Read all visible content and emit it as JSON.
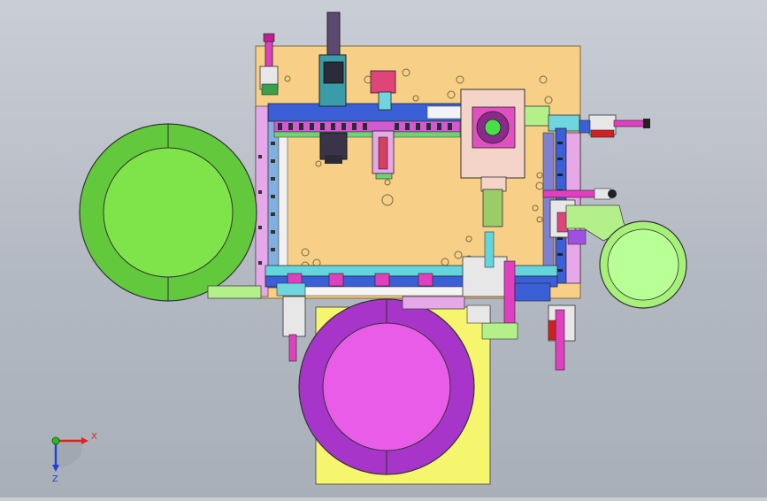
{
  "axis_triad": {
    "x_label": "X",
    "z_label": "Z"
  },
  "colors": {
    "plate": "#f7cf86",
    "plate_edge": "#8a7a55",
    "green_bowl": "#62c93c",
    "green_bowl_inner": "#7fe44a",
    "light_green_bowl": "#a7f07a",
    "light_green_bowl_inner": "#b8ff96",
    "purple_bowl": "#a735c9",
    "purple_bowl_inner": "#e85ce8",
    "yellow_base": "#f6f56e",
    "blue_rail": "#3b5fd6",
    "magenta": "#e040c0",
    "cyan": "#62d6dc",
    "dark": "#3a3a4a"
  }
}
